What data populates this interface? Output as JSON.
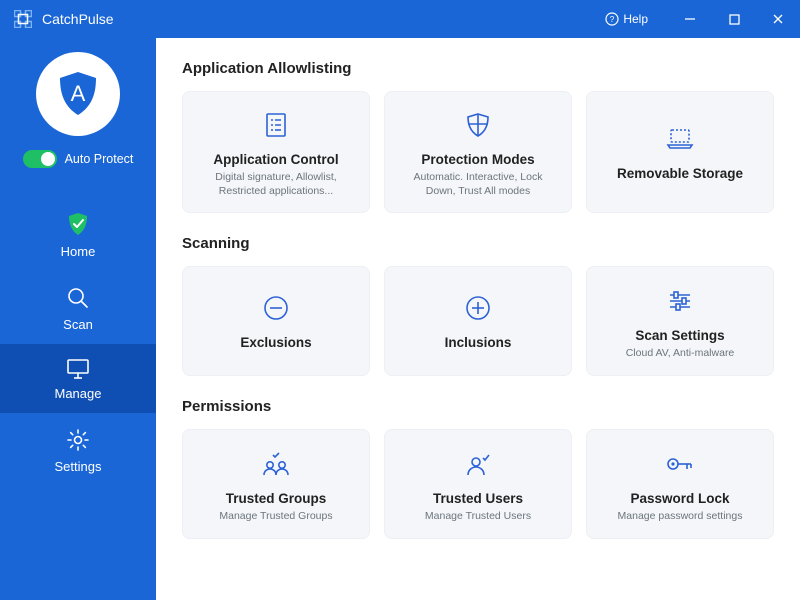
{
  "app": {
    "title": "CatchPulse"
  },
  "titlebar": {
    "help_label": "Help"
  },
  "sidebar": {
    "auto_protect_label": "Auto Protect",
    "nav": {
      "home": "Home",
      "scan": "Scan",
      "manage": "Manage",
      "settings": "Settings"
    }
  },
  "main": {
    "sections": {
      "allowlisting": {
        "title": "Application Allowlisting",
        "cards": {
          "app_control": {
            "title": "Application Control",
            "desc": "Digital signature, Allowlist, Restricted applications..."
          },
          "protection_modes": {
            "title": "Protection Modes",
            "desc": "Automatic. Interactive, Lock Down, Trust All modes"
          },
          "removable_storage": {
            "title": "Removable Storage",
            "desc": ""
          }
        }
      },
      "scanning": {
        "title": "Scanning",
        "cards": {
          "exclusions": {
            "title": "Exclusions",
            "desc": ""
          },
          "inclusions": {
            "title": "Inclusions",
            "desc": ""
          },
          "scan_settings": {
            "title": "Scan Settings",
            "desc": "Cloud AV, Anti-malware"
          }
        }
      },
      "permissions": {
        "title": "Permissions",
        "cards": {
          "trusted_groups": {
            "title": "Trusted Groups",
            "desc": "Manage Trusted Groups"
          },
          "trusted_users": {
            "title": "Trusted Users",
            "desc": "Manage Trusted Users"
          },
          "password_lock": {
            "title": "Password Lock",
            "desc": "Manage password settings"
          }
        }
      }
    }
  }
}
